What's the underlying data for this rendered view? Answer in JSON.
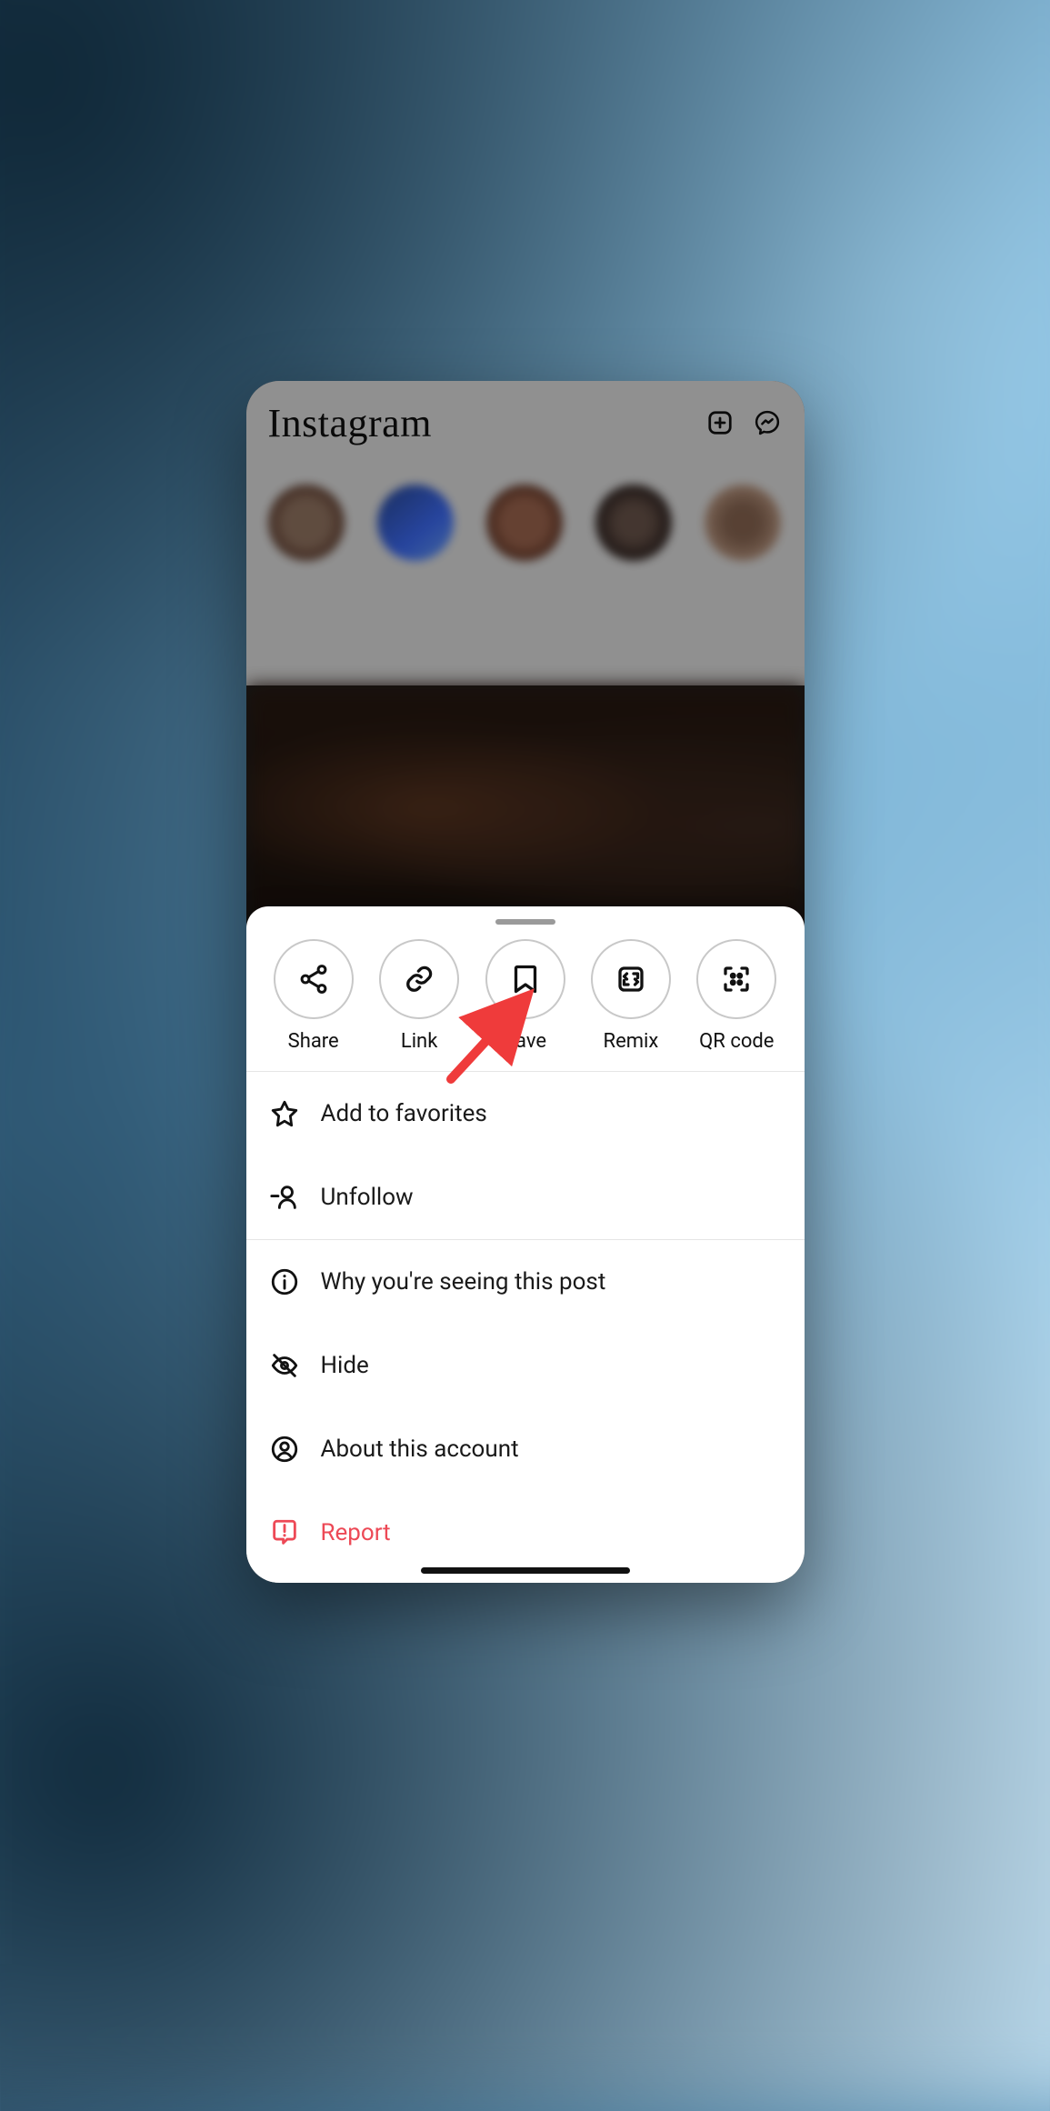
{
  "app": {
    "name": "Instagram"
  },
  "colors": {
    "report": "#ed4956"
  },
  "sheet": {
    "actions": [
      {
        "id": "share",
        "label": "Share"
      },
      {
        "id": "link",
        "label": "Link"
      },
      {
        "id": "save",
        "label": "Save"
      },
      {
        "id": "remix",
        "label": "Remix"
      },
      {
        "id": "qrcode",
        "label": "QR code"
      }
    ],
    "menu": {
      "favorites": "Add to favorites",
      "unfollow": "Unfollow",
      "why": "Why you're seeing this post",
      "hide": "Hide",
      "about": "About this account",
      "report": "Report"
    }
  },
  "annotation": {
    "target": "save"
  }
}
